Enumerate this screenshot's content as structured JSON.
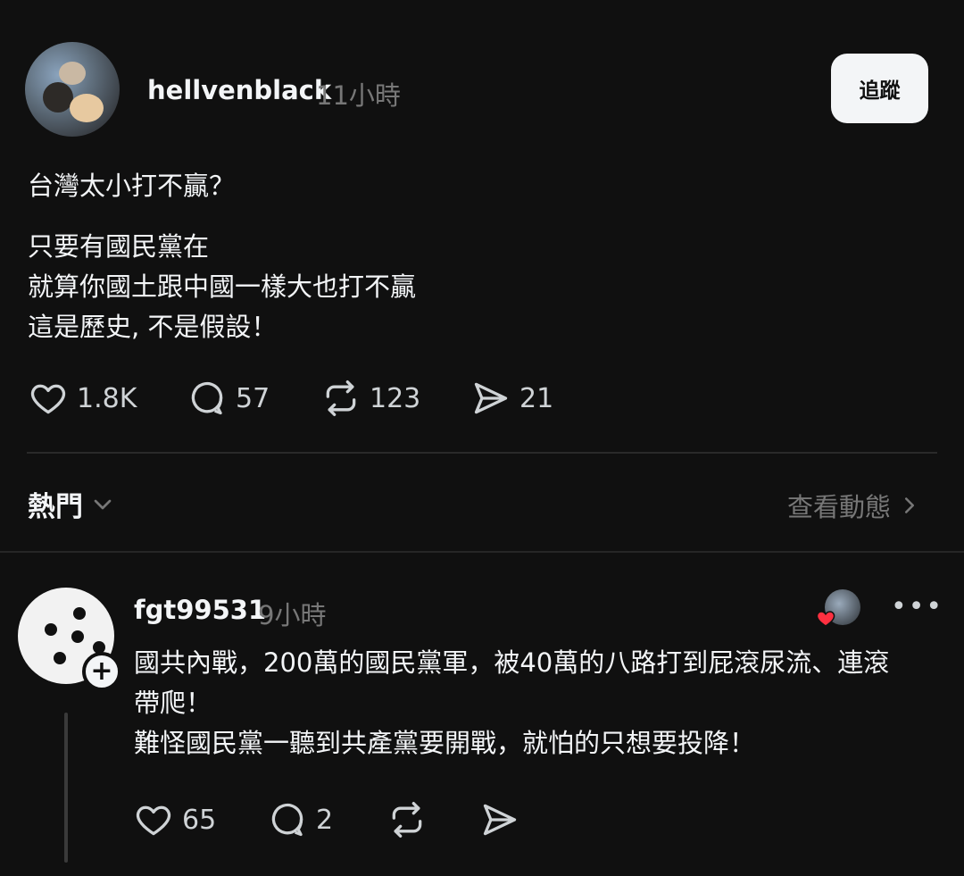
{
  "post": {
    "username": "hellvenblack",
    "time": "11小時",
    "follow_label": "追蹤",
    "text_lines": [
      "台灣太小打不贏？",
      "只要有國民黨在",
      "就算你國土跟中國一樣大也打不贏",
      "這是歷史, 不是假設！"
    ],
    "stats": {
      "likes": "1.8K",
      "comments": "57",
      "reposts": "123",
      "shares": "21"
    }
  },
  "filter": {
    "label": "熱門",
    "view_activity": "查看動態"
  },
  "reply": {
    "username": "fgt99531",
    "time": "9小時",
    "more": "•••",
    "text_lines": [
      "國共內戰，200萬的國民黨軍，被40萬的八路打到屁滾尿流、連滾",
      "帶爬！",
      "難怪國民黨一聽到共產黨要開戰，就怕的只想要投降！"
    ],
    "stats": {
      "likes": "65",
      "comments": "2"
    }
  },
  "icons": {
    "like": "heart-icon",
    "comment": "comment-bubble-icon",
    "repost": "repost-icon",
    "share": "send-icon",
    "chevron": "chevron-icon"
  },
  "colors": {
    "background": "#101010",
    "text": "#f3f5f7",
    "muted": "#777777",
    "like_badge": "#ff3040"
  }
}
